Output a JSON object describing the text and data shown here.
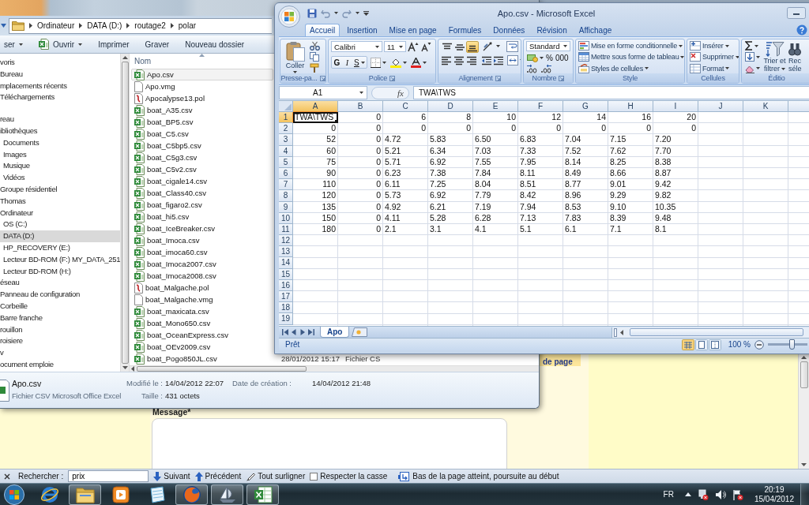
{
  "explorer": {
    "breadcrumb": [
      "Ordinateur",
      "DATA (D:)",
      "routage2",
      "polar"
    ],
    "toolbar": [
      {
        "label": "ser",
        "kind": "menu"
      },
      {
        "label": "Ouvrir",
        "kind": "open"
      },
      {
        "label": "Imprimer",
        "kind": "plain"
      },
      {
        "label": "Graver",
        "kind": "plain"
      },
      {
        "label": "Nouveau dossier",
        "kind": "plain"
      }
    ],
    "nav_sections": [
      {
        "items": [
          {
            "label": "voris",
            "selected": false
          },
          {
            "label": "Bureau",
            "selected": false
          },
          {
            "label": "mplacements récents",
            "selected": false
          },
          {
            "label": "Téléchargements",
            "selected": false
          }
        ]
      },
      {
        "items": [
          {
            "label": "reau",
            "selected": false
          },
          {
            "label": "ibliothèques",
            "selected": false,
            "children": [
              {
                "label": "Documents",
                "selected": false
              },
              {
                "label": "Images",
                "selected": false
              },
              {
                "label": "Musique",
                "selected": false
              },
              {
                "label": "Vidéos",
                "selected": false
              }
            ]
          },
          {
            "label": "Groupe résidentiel",
            "selected": false
          },
          {
            "label": "Thomas",
            "selected": false
          },
          {
            "label": "Ordinateur",
            "selected": false,
            "children": [
              {
                "label": "OS (C:)",
                "selected": false
              },
              {
                "label": "DATA (D:)",
                "selected": true
              },
              {
                "label": "HP_RECOVERY (E:)",
                "selected": false
              },
              {
                "label": "Lecteur BD-ROM (F:) MY_DATA_251",
                "selected": false
              },
              {
                "label": "Lecteur BD-ROM (H:)",
                "selected": false
              }
            ]
          },
          {
            "label": "éseau",
            "selected": false
          },
          {
            "label": "Panneau de configuration",
            "selected": false
          },
          {
            "label": "Corbeille",
            "selected": false
          },
          {
            "label": "Barre franche",
            "selected": false
          },
          {
            "label": "rouillon",
            "selected": false
          },
          {
            "label": "roisiere",
            "selected": false
          },
          {
            "label": "v",
            "selected": false
          },
          {
            "label": "ocument emploie",
            "selected": false
          }
        ]
      }
    ],
    "list_header": "Nom",
    "files": [
      {
        "name": "Apo.csv",
        "kind": "csv",
        "selected": true
      },
      {
        "name": "Apo.vmg",
        "kind": "vmg",
        "selected": false
      },
      {
        "name": "Apocalypse13.pol",
        "kind": "pol",
        "selected": false
      },
      {
        "name": "boat_A35.csv",
        "kind": "csv",
        "selected": false
      },
      {
        "name": "boat_BP5.csv",
        "kind": "csv",
        "selected": false
      },
      {
        "name": "boat_C5.csv",
        "kind": "csv",
        "selected": false
      },
      {
        "name": "boat_C5bp5.csv",
        "kind": "csv",
        "selected": false
      },
      {
        "name": "boat_C5g3.csv",
        "kind": "csv",
        "selected": false
      },
      {
        "name": "boat_C5v2.csv",
        "kind": "csv",
        "selected": false
      },
      {
        "name": "boat_cigale14.csv",
        "kind": "csv",
        "selected": false
      },
      {
        "name": "boat_Class40.csv",
        "kind": "csv",
        "selected": false
      },
      {
        "name": "boat_figaro2.csv",
        "kind": "csv",
        "selected": false
      },
      {
        "name": "boat_hi5.csv",
        "kind": "csv",
        "selected": false
      },
      {
        "name": "boat_IceBreaker.csv",
        "kind": "csv",
        "selected": false
      },
      {
        "name": "boat_Imoca.csv",
        "kind": "csv",
        "selected": false
      },
      {
        "name": "boat_imoca60.csv",
        "kind": "csv",
        "selected": false
      },
      {
        "name": "boat_Imoca2007.csv",
        "kind": "csv",
        "selected": false
      },
      {
        "name": "boat_Imoca2008.csv",
        "kind": "csv",
        "selected": false
      },
      {
        "name": "boat_Malgache.pol",
        "kind": "pol",
        "selected": false
      },
      {
        "name": "boat_Malgache.vmg",
        "kind": "vmg",
        "selected": false
      },
      {
        "name": "boat_maxicata.csv",
        "kind": "csv",
        "selected": false
      },
      {
        "name": "boat_Mono650.csv",
        "kind": "csv",
        "selected": false
      },
      {
        "name": "boat_OceanExpress.csv",
        "kind": "csv",
        "selected": false
      },
      {
        "name": "boat_OEv2009.csv",
        "kind": "csv",
        "selected": false
      },
      {
        "name": "boat_Pogo850JL.csv",
        "kind": "csv",
        "selected": false,
        "date": "28/01/2012 15:17",
        "type": "Fichier CS"
      }
    ],
    "details": {
      "name": "Apo.csv",
      "type": "Fichier CSV Microsoft Office Excel",
      "property_columns": [
        [
          {
            "label": "Modifié le :",
            "value": "14/04/2012 22:07"
          },
          {
            "label": "Taille :",
            "value": "431 octets"
          }
        ],
        [
          {
            "label": "Date de création :",
            "value": "14/04/2012 21:48"
          }
        ]
      ]
    }
  },
  "excel": {
    "title": "Apo.csv - Microsoft Excel",
    "tabs": [
      {
        "label": "Accueil",
        "selected": true
      },
      {
        "label": "Insertion",
        "selected": false
      },
      {
        "label": "Mise en page",
        "selected": false
      },
      {
        "label": "Formules",
        "selected": false
      },
      {
        "label": "Données",
        "selected": false
      },
      {
        "label": "Révision",
        "selected": false
      },
      {
        "label": "Affichage",
        "selected": false
      }
    ],
    "ribbon": [
      {
        "kind": "clipboard",
        "label": "Presse-pa...",
        "paste": "Coller"
      },
      {
        "kind": "font",
        "label": "Police",
        "font": "Calibri",
        "size": "11",
        "bold": "G",
        "italic": "I",
        "underline": "S"
      },
      {
        "kind": "alignment",
        "label": "Alignement",
        "valign": [
          {
            "on": false
          },
          {
            "on": false
          },
          {
            "on": true
          }
        ]
      },
      {
        "kind": "number",
        "label": "Nombre",
        "format": "Standard",
        "percent": "%",
        "thousands": "000"
      },
      {
        "kind": "styles",
        "label": "Style",
        "items": [
          "Mise en forme conditionnelle",
          "Mettre sous forme de tableau",
          "Styles de cellules"
        ]
      },
      {
        "kind": "cells",
        "label": "Cellules",
        "items": [
          "Insérer",
          "Supprimer",
          "Format"
        ]
      },
      {
        "kind": "editing",
        "label": "Éditio",
        "sort": "Trier et filtrer",
        "find": "Rec séle"
      }
    ],
    "name_box": "A1",
    "fx": "fx",
    "formula": "TWA\\TWS",
    "columns": [
      {
        "label": "A",
        "selected": true
      },
      {
        "label": "B",
        "selected": false
      },
      {
        "label": "C",
        "selected": false
      },
      {
        "label": "D",
        "selected": false
      },
      {
        "label": "E",
        "selected": false
      },
      {
        "label": "F",
        "selected": false
      },
      {
        "label": "G",
        "selected": false
      },
      {
        "label": "H",
        "selected": false
      },
      {
        "label": "I",
        "selected": false
      },
      {
        "label": "J",
        "selected": false
      },
      {
        "label": "K",
        "selected": false
      }
    ],
    "rows": [
      {
        "header": "1",
        "selected": true,
        "cells": [
          {
            "value": "TWA\\TWS",
            "kind": "text"
          },
          {
            "value": "0",
            "kind": "number"
          },
          {
            "value": "6",
            "kind": "number"
          },
          {
            "value": "8",
            "kind": "number"
          },
          {
            "value": "10",
            "kind": "number"
          },
          {
            "value": "12",
            "kind": "number"
          },
          {
            "value": "14",
            "kind": "number"
          },
          {
            "value": "16",
            "kind": "number"
          },
          {
            "value": "20",
            "kind": "number"
          }
        ]
      },
      {
        "header": "2",
        "selected": false,
        "cells": [
          {
            "value": "0",
            "kind": "number"
          },
          {
            "value": "0",
            "kind": "number"
          },
          {
            "value": "0",
            "kind": "number"
          },
          {
            "value": "0",
            "kind": "number"
          },
          {
            "value": "0",
            "kind": "number"
          },
          {
            "value": "0",
            "kind": "number"
          },
          {
            "value": "0",
            "kind": "number"
          },
          {
            "value": "0",
            "kind": "number"
          },
          {
            "value": "0",
            "kind": "number"
          }
        ]
      },
      {
        "header": "3",
        "selected": false,
        "cells": [
          {
            "value": "52",
            "kind": "number"
          },
          {
            "value": "0",
            "kind": "number"
          },
          {
            "value": "4.72",
            "kind": "text"
          },
          {
            "value": "5.83",
            "kind": "text"
          },
          {
            "value": "6.50",
            "kind": "text"
          },
          {
            "value": "6.83",
            "kind": "text"
          },
          {
            "value": "7.04",
            "kind": "text"
          },
          {
            "value": "7.15",
            "kind": "text"
          },
          {
            "value": "7.20",
            "kind": "text"
          }
        ]
      },
      {
        "header": "4",
        "selected": false,
        "cells": [
          {
            "value": "60",
            "kind": "number"
          },
          {
            "value": "0",
            "kind": "number"
          },
          {
            "value": "5.21",
            "kind": "text"
          },
          {
            "value": "6.34",
            "kind": "text"
          },
          {
            "value": "7.03",
            "kind": "text"
          },
          {
            "value": "7.33",
            "kind": "text"
          },
          {
            "value": "7.52",
            "kind": "text"
          },
          {
            "value": "7.62",
            "kind": "text"
          },
          {
            "value": "7.70",
            "kind": "text"
          }
        ]
      },
      {
        "header": "5",
        "selected": false,
        "cells": [
          {
            "value": "75",
            "kind": "number"
          },
          {
            "value": "0",
            "kind": "number"
          },
          {
            "value": "5.71",
            "kind": "text"
          },
          {
            "value": "6.92",
            "kind": "text"
          },
          {
            "value": "7.55",
            "kind": "text"
          },
          {
            "value": "7.95",
            "kind": "text"
          },
          {
            "value": "8.14",
            "kind": "text"
          },
          {
            "value": "8.25",
            "kind": "text"
          },
          {
            "value": "8.38",
            "kind": "text"
          }
        ]
      },
      {
        "header": "6",
        "selected": false,
        "cells": [
          {
            "value": "90",
            "kind": "number"
          },
          {
            "value": "0",
            "kind": "number"
          },
          {
            "value": "6.23",
            "kind": "text"
          },
          {
            "value": "7.38",
            "kind": "text"
          },
          {
            "value": "7.84",
            "kind": "text"
          },
          {
            "value": "8.11",
            "kind": "text"
          },
          {
            "value": "8.49",
            "kind": "text"
          },
          {
            "value": "8.66",
            "kind": "text"
          },
          {
            "value": "8.87",
            "kind": "text"
          }
        ]
      },
      {
        "header": "7",
        "selected": false,
        "cells": [
          {
            "value": "110",
            "kind": "number"
          },
          {
            "value": "0",
            "kind": "number"
          },
          {
            "value": "6.11",
            "kind": "text"
          },
          {
            "value": "7.25",
            "kind": "text"
          },
          {
            "value": "8.04",
            "kind": "text"
          },
          {
            "value": "8.51",
            "kind": "text"
          },
          {
            "value": "8.77",
            "kind": "text"
          },
          {
            "value": "9.01",
            "kind": "text"
          },
          {
            "value": "9.42",
            "kind": "text"
          }
        ]
      },
      {
        "header": "8",
        "selected": false,
        "cells": [
          {
            "value": "120",
            "kind": "number"
          },
          {
            "value": "0",
            "kind": "number"
          },
          {
            "value": "5.73",
            "kind": "text"
          },
          {
            "value": "6.92",
            "kind": "text"
          },
          {
            "value": "7.79",
            "kind": "text"
          },
          {
            "value": "8.42",
            "kind": "text"
          },
          {
            "value": "8.96",
            "kind": "text"
          },
          {
            "value": "9.29",
            "kind": "text"
          },
          {
            "value": "9.82",
            "kind": "text"
          }
        ]
      },
      {
        "header": "9",
        "selected": false,
        "cells": [
          {
            "value": "135",
            "kind": "number"
          },
          {
            "value": "0",
            "kind": "number"
          },
          {
            "value": "4.92",
            "kind": "text"
          },
          {
            "value": "6.21",
            "kind": "text"
          },
          {
            "value": "7.19",
            "kind": "text"
          },
          {
            "value": "7.94",
            "kind": "text"
          },
          {
            "value": "8.53",
            "kind": "text"
          },
          {
            "value": "9.10",
            "kind": "text"
          },
          {
            "value": "10.35",
            "kind": "text"
          }
        ]
      },
      {
        "header": "10",
        "selected": false,
        "cells": [
          {
            "value": "150",
            "kind": "number"
          },
          {
            "value": "0",
            "kind": "number"
          },
          {
            "value": "4.11",
            "kind": "text"
          },
          {
            "value": "5.28",
            "kind": "text"
          },
          {
            "value": "6.28",
            "kind": "text"
          },
          {
            "value": "7.13",
            "kind": "text"
          },
          {
            "value": "7.83",
            "kind": "text"
          },
          {
            "value": "8.39",
            "kind": "text"
          },
          {
            "value": "9.48",
            "kind": "text"
          }
        ]
      },
      {
        "header": "11",
        "selected": false,
        "cells": [
          {
            "value": "180",
            "kind": "number"
          },
          {
            "value": "0",
            "kind": "number"
          },
          {
            "value": "2.1",
            "kind": "text"
          },
          {
            "value": "3.1",
            "kind": "text"
          },
          {
            "value": "4.1",
            "kind": "text"
          },
          {
            "value": "5.1",
            "kind": "text"
          },
          {
            "value": "6.1",
            "kind": "text"
          },
          {
            "value": "7.1",
            "kind": "text"
          },
          {
            "value": "8.1",
            "kind": "text"
          }
        ]
      },
      {
        "header": "12",
        "selected": false,
        "cells": []
      },
      {
        "header": "13",
        "selected": false,
        "cells": []
      },
      {
        "header": "14",
        "selected": false,
        "cells": []
      },
      {
        "header": "15",
        "selected": false,
        "cells": []
      },
      {
        "header": "16",
        "selected": false,
        "cells": []
      },
      {
        "header": "17",
        "selected": false,
        "cells": []
      },
      {
        "header": "18",
        "selected": false,
        "cells": []
      },
      {
        "header": "19",
        "selected": false,
        "cells": []
      }
    ],
    "sheets": [
      {
        "label": "Apo",
        "selected": true
      }
    ],
    "status": "Prêt",
    "views": [
      {
        "kind": "normal",
        "selected": true
      },
      {
        "kind": "layout",
        "selected": false
      },
      {
        "kind": "break",
        "selected": false
      }
    ],
    "zoom": "100 %",
    "zoom_slider": {
      "level": 0.6
    }
  },
  "browser": {
    "note": "de page",
    "message_label": "Message*"
  },
  "find_bar": {
    "label": "Rechercher :",
    "query": "prix",
    "next": "Suivant",
    "previous": "Précédent",
    "highlight": "Tout surligner",
    "match_case": {
      "label": "Respecter la casse",
      "checked": false
    },
    "status": "Bas de la page atteint, poursuite au début"
  },
  "taskbar": {
    "apps": [
      {
        "kind": "ie",
        "running": false
      },
      {
        "kind": "folder",
        "running": true
      },
      {
        "kind": "media",
        "running": false
      },
      {
        "kind": "notes",
        "running": false
      },
      {
        "kind": "firefox",
        "running": true
      },
      {
        "kind": "boat",
        "running": true
      },
      {
        "kind": "excel",
        "running": true
      }
    ],
    "language": "FR",
    "time": "20:19",
    "date": "15/04/2012"
  }
}
